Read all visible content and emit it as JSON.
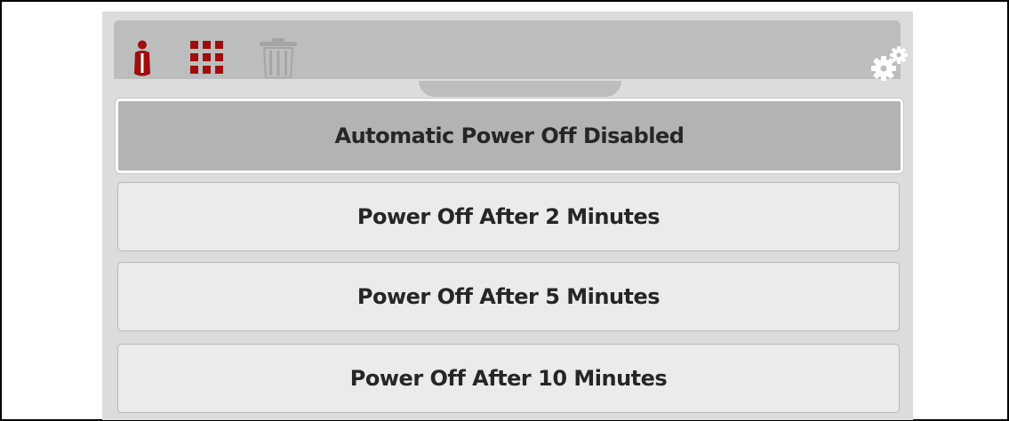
{
  "toolbar": {
    "icons": [
      "info-icon",
      "grid-icon",
      "trash-icon",
      "settings-gears-icon"
    ],
    "colors": {
      "accent": "#a00d0d",
      "toolbar_bg": "#bcbebe",
      "trash_disabled": "#a4a6a6"
    }
  },
  "power_options": [
    {
      "label": "Automatic Power Off Disabled",
      "selected": true
    },
    {
      "label": "Power Off After 2 Minutes",
      "selected": false
    },
    {
      "label": "Power Off After 5 Minutes",
      "selected": false
    },
    {
      "label": "Power Off After 10 Minutes",
      "selected": false
    }
  ]
}
